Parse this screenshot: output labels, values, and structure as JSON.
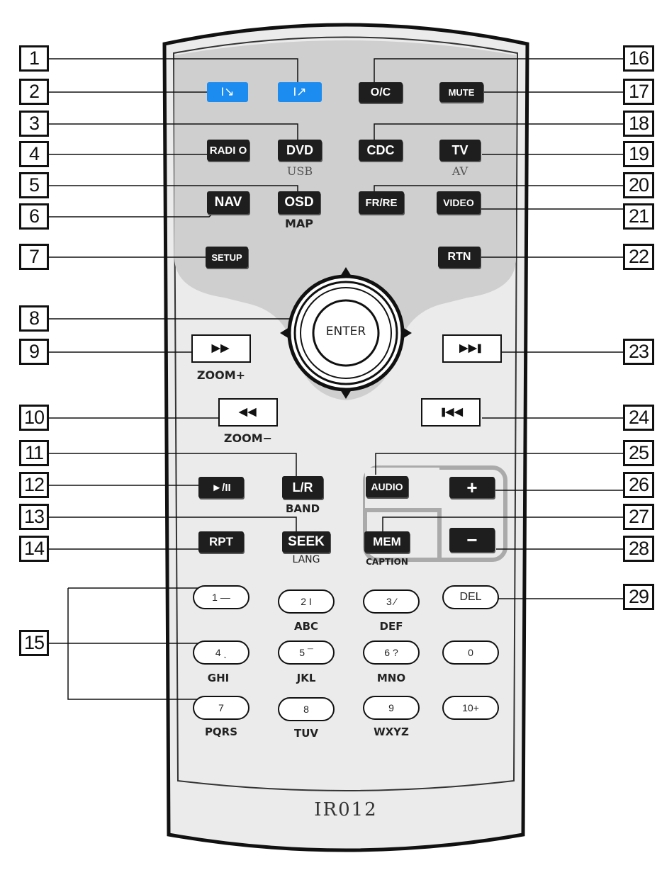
{
  "model": "IR012",
  "enter_label": "ENTER",
  "callouts": [
    "1",
    "2",
    "3",
    "4",
    "5",
    "6",
    "7",
    "8",
    "9",
    "10",
    "11",
    "12",
    "13",
    "14",
    "15",
    "16",
    "17",
    "18",
    "19",
    "20",
    "21",
    "22",
    "23",
    "24",
    "25",
    "26",
    "27",
    "28",
    "29"
  ],
  "buttons": {
    "vol_down": "I↘",
    "vol_up": "I↗",
    "open_close": "O/C",
    "mute": "MUTE",
    "radio": "RADI O",
    "dvd": "DVD",
    "cdc": "CDC",
    "tv": "TV",
    "nav": "NAV",
    "osd": "OSD",
    "fr_re": "FR/RE",
    "video": "VIDEO",
    "setup": "SETUP",
    "rtn": "RTN",
    "lr": "L/R",
    "audio": "AUDIO",
    "rpt": "RPT",
    "seek": "SEEK",
    "mem": "MEM",
    "plus": "+",
    "minus": "−",
    "play_pause": "►/II"
  },
  "sublabels": {
    "usb": "USB",
    "av": "AV",
    "map": "MAP",
    "zoom_plus": "ZOOM+",
    "zoom_minus": "ZOOM−",
    "band": "BAND",
    "lang": "LANG",
    "caption": "CAPTION"
  },
  "keypad": [
    {
      "key": "1 —",
      "letters": ""
    },
    {
      "key": "2 I",
      "letters": "ABC"
    },
    {
      "key": "3 ⁄",
      "letters": "DEF"
    },
    {
      "key": "DEL",
      "letters": ""
    },
    {
      "key": "4 ˎ",
      "letters": "GHI"
    },
    {
      "key": "5 ¯",
      "letters": "JKL"
    },
    {
      "key": "6 ?",
      "letters": "MNO"
    },
    {
      "key": "0",
      "letters": ""
    },
    {
      "key": "7",
      "letters": "PQRS"
    },
    {
      "key": "8",
      "letters": "TUV"
    },
    {
      "key": "9",
      "letters": "WXYZ"
    },
    {
      "key": "10+",
      "letters": ""
    }
  ],
  "colors": {
    "blue_button": "#1d8cf0",
    "dark_button": "#1e1e1e",
    "panel_gray": "#cccccc",
    "body": "#e6e6e6"
  }
}
